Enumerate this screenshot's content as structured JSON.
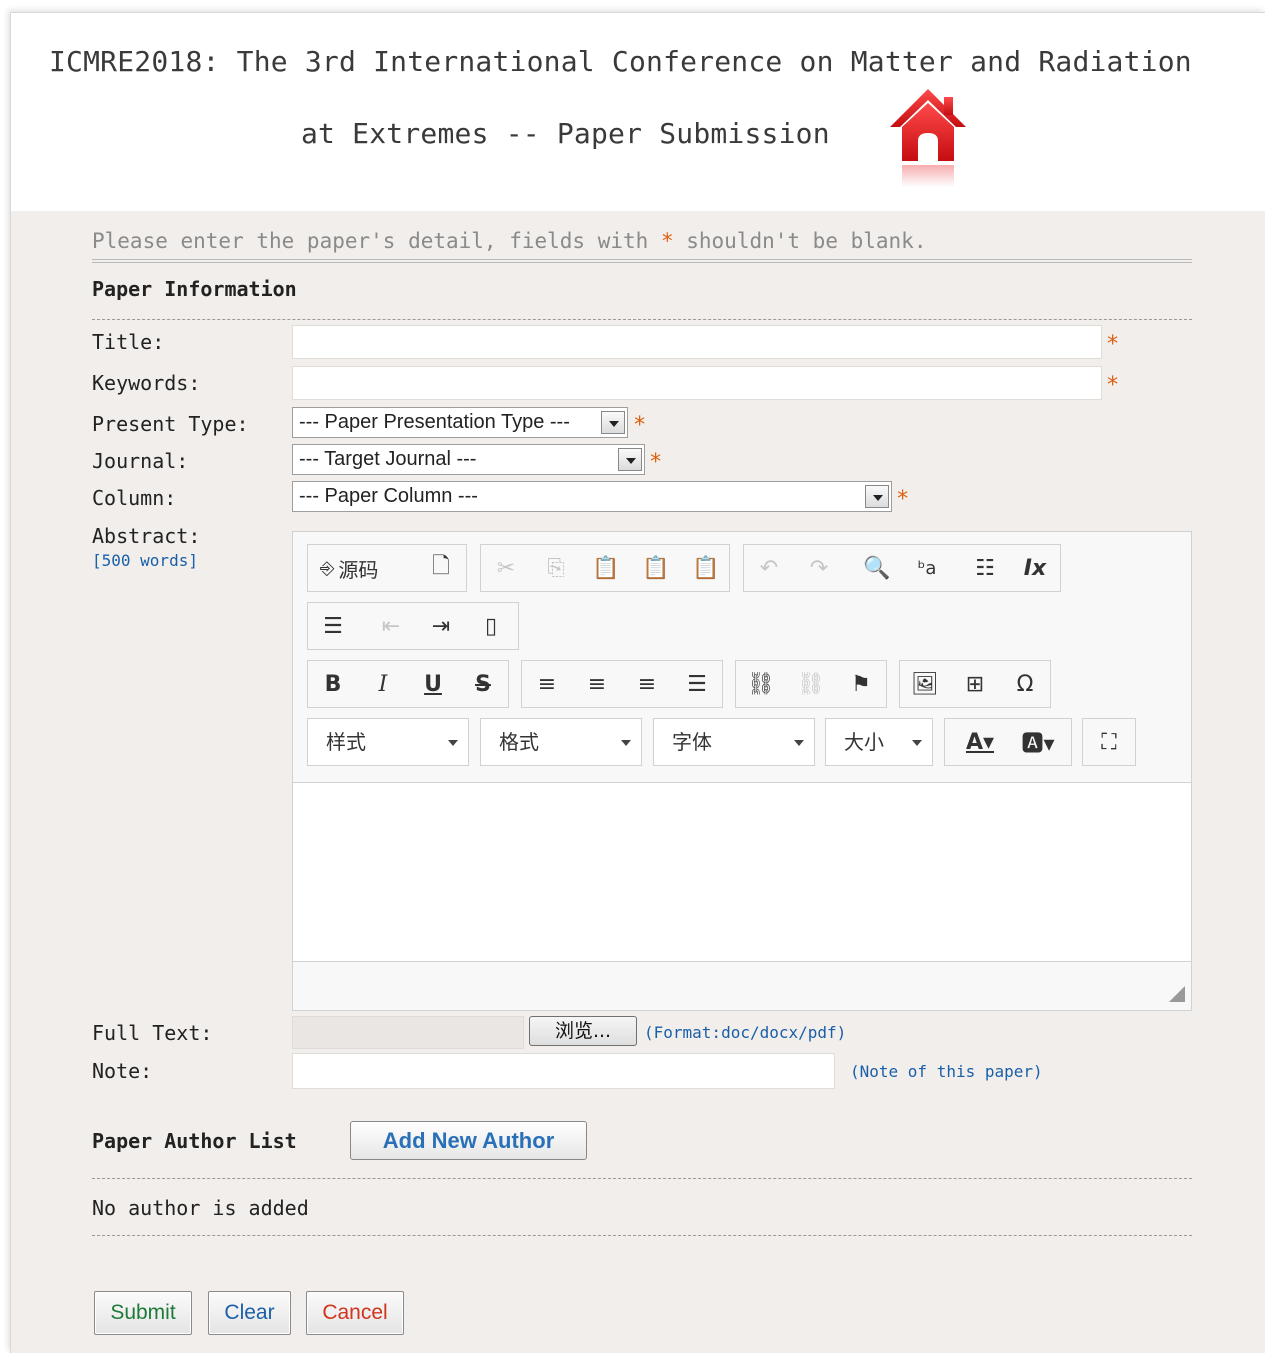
{
  "header": {
    "title_line1": "ICMRE2018: The 3rd International Conference on Matter and Radiation",
    "title_line2": "at Extremes -- Paper Submission",
    "home_icon": "home-icon",
    "home_icon_color": "#e8141b"
  },
  "intro": {
    "before": "Please enter the paper's detail, fields with ",
    "star": "*",
    "after": " shouldn't be blank."
  },
  "paper_info": {
    "section_title": "Paper Information",
    "title_label": "Title:",
    "title_value": "",
    "keywords_label": "Keywords:",
    "keywords_value": "",
    "present_type_label": "Present Type:",
    "present_type_selected": "--- Paper Presentation Type ---",
    "journal_label": "Journal:",
    "journal_selected": "--- Target Journal ---",
    "column_label": "Column:",
    "column_selected": "--- Paper Column ---",
    "required_mark": "*",
    "abstract_label": "Abstract:",
    "abstract_hint": "[500 words]",
    "full_text_label": "Full Text:",
    "browse_label": "浏览...",
    "full_text_hint": "(Format:doc/docx/pdf)",
    "note_label": "Note:",
    "note_value": "",
    "note_hint": "(Note of this paper)"
  },
  "editor": {
    "source_label": "源码",
    "combos": {
      "styles": "样式",
      "format": "格式",
      "font": "字体",
      "size": "大小"
    },
    "content": "",
    "icons": [
      "source-icon",
      "preview-icon",
      "cut-icon",
      "copy-icon",
      "paste-icon",
      "paste-text-icon",
      "paste-word-icon",
      "undo-icon",
      "redo-icon",
      "find-icon",
      "replace-icon",
      "select-all-icon",
      "remove-format-icon",
      "bulleted-list-icon",
      "outdent-icon",
      "indent-icon",
      "create-div-icon",
      "bold-icon",
      "italic-icon",
      "underline-icon",
      "strikethrough-icon",
      "align-left-icon",
      "align-center-icon",
      "align-right-icon",
      "justify-icon",
      "link-icon",
      "unlink-icon",
      "anchor-icon",
      "image-icon",
      "table-icon",
      "special-char-icon",
      "text-color-icon",
      "bg-color-icon",
      "maximize-icon"
    ]
  },
  "authors": {
    "section_title": "Paper Author List",
    "add_button": "Add New Author",
    "empty_text": "No author is added"
  },
  "actions": {
    "submit": "Submit",
    "clear": "Clear",
    "cancel": "Cancel"
  },
  "colors": {
    "page_bg": "#f1eeeb",
    "required": "#e06010",
    "hint": "#1a5fa8",
    "submit_text": "#1f7a3a",
    "clear_text": "#1a5fa8",
    "cancel_text": "#d0341c"
  }
}
